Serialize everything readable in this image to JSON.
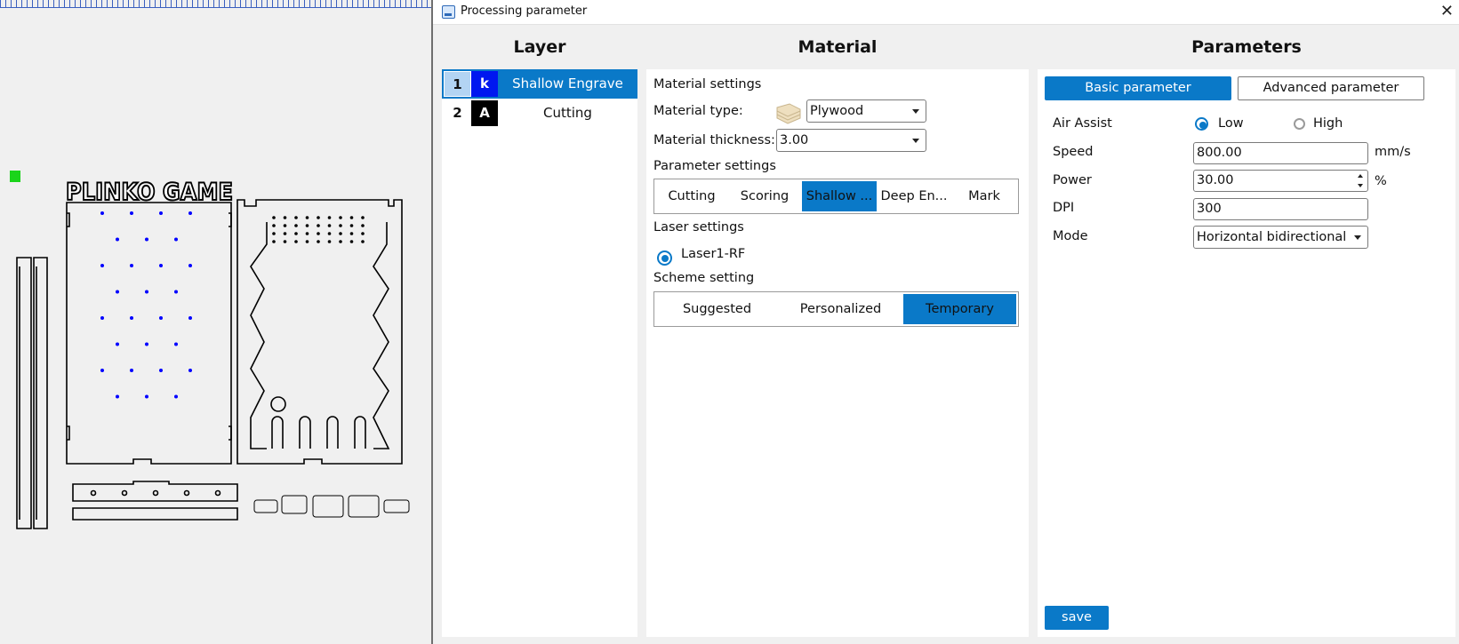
{
  "dialog": {
    "title": "Processing parameter",
    "icon": "app-icon",
    "close_icon": "close-icon"
  },
  "canvas": {
    "design_title": "PLINKO GAME",
    "engrave_color": "#0000ff"
  },
  "columns": {
    "layer": "Layer",
    "material": "Material",
    "parameters": "Parameters"
  },
  "layers": [
    {
      "number": "1",
      "swatch": "k",
      "swatch_color": "#0018f0",
      "name": "Shallow Engrave",
      "selected": true
    },
    {
      "number": "2",
      "swatch": "A",
      "swatch_color": "#000000",
      "name": "Cutting",
      "selected": false
    }
  ],
  "material": {
    "settings_label": "Material settings",
    "type_label": "Material type:",
    "type_value": "Plywood",
    "thickness_label": "Material thickness:",
    "thickness_value": "3.00",
    "parameter_settings_label": "Parameter settings",
    "process_tabs": [
      "Cutting",
      "Scoring",
      "Shallow ...",
      "Deep En...",
      "Mark"
    ],
    "process_selected": "Shallow ...",
    "laser_settings_label": "Laser settings",
    "laser_option": "Laser1-RF",
    "scheme_label": "Scheme setting",
    "scheme_tabs": [
      "Suggested",
      "Personalized",
      "Temporary"
    ],
    "scheme_selected": "Temporary"
  },
  "parameters": {
    "tabs": [
      "Basic parameter",
      "Advanced parameter"
    ],
    "tab_selected": "Basic parameter",
    "air_assist_label": "Air Assist",
    "air_assist_options": [
      "Low",
      "High"
    ],
    "air_assist_selected": "Low",
    "speed_label": "Speed",
    "speed_value": "800.00",
    "speed_unit": "mm/s",
    "power_label": "Power",
    "power_value": "30.00",
    "power_unit": "%",
    "dpi_label": "DPI",
    "dpi_value": "300",
    "mode_label": "Mode",
    "mode_value": "Horizontal bidirectional",
    "save_label": "save"
  },
  "colors": {
    "accent": "#0a79c8",
    "layer1_swatch": "#0018f0",
    "layer2_swatch": "#000000"
  }
}
